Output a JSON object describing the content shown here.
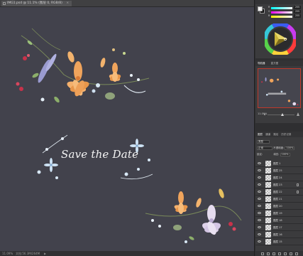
{
  "document": {
    "tab_title": "IMG1.psd @ 11.1% (图层 0, RGB/8)",
    "close_glyph": "×"
  },
  "canvas": {
    "background_color": "#42424c",
    "headline": "Save the Date"
  },
  "status_bar": {
    "zoom": "11.09%",
    "doc_info": "文档:56.3M/264M",
    "arrow": "▶"
  },
  "color_panel": {
    "sliders": [
      {
        "label": "R",
        "value": "255"
      },
      {
        "label": "G",
        "value": "255"
      },
      {
        "label": "B",
        "value": "255"
      }
    ],
    "foreground_color": "#f2f2f2",
    "background_color": "#111111"
  },
  "navigator": {
    "tabs": [
      "导航器",
      "直方图"
    ],
    "zoom": "11.09%"
  },
  "layers_panel": {
    "tabs": [
      "图层",
      "通道",
      "路径",
      "历史记录"
    ],
    "filter_label": "类型",
    "blend_mode": "正常",
    "opacity_label": "不透明度:",
    "opacity_value": "100%",
    "lock_label": "锁定:",
    "fill_label": "填充:",
    "fill_value": "100%",
    "layers": [
      {
        "name": "图层 1",
        "selected": false,
        "fx": false
      },
      {
        "name": "图层 25",
        "selected": false,
        "fx": false
      },
      {
        "name": "图层 24",
        "selected": false,
        "fx": false
      },
      {
        "name": "图层 23",
        "selected": false,
        "fx": true
      },
      {
        "name": "图层 22",
        "selected": false,
        "fx": true
      },
      {
        "name": "图层 21",
        "selected": false,
        "fx": false
      },
      {
        "name": "图层 20",
        "selected": false,
        "fx": false
      },
      {
        "name": "图层 19",
        "selected": false,
        "fx": false
      },
      {
        "name": "图层 18",
        "selected": false,
        "fx": false
      },
      {
        "name": "图层 17",
        "selected": false,
        "fx": false
      },
      {
        "name": "图层 16",
        "selected": false,
        "fx": false
      },
      {
        "name": "图层 15",
        "selected": false,
        "fx": false
      }
    ]
  },
  "accent_color": "#c0392b"
}
